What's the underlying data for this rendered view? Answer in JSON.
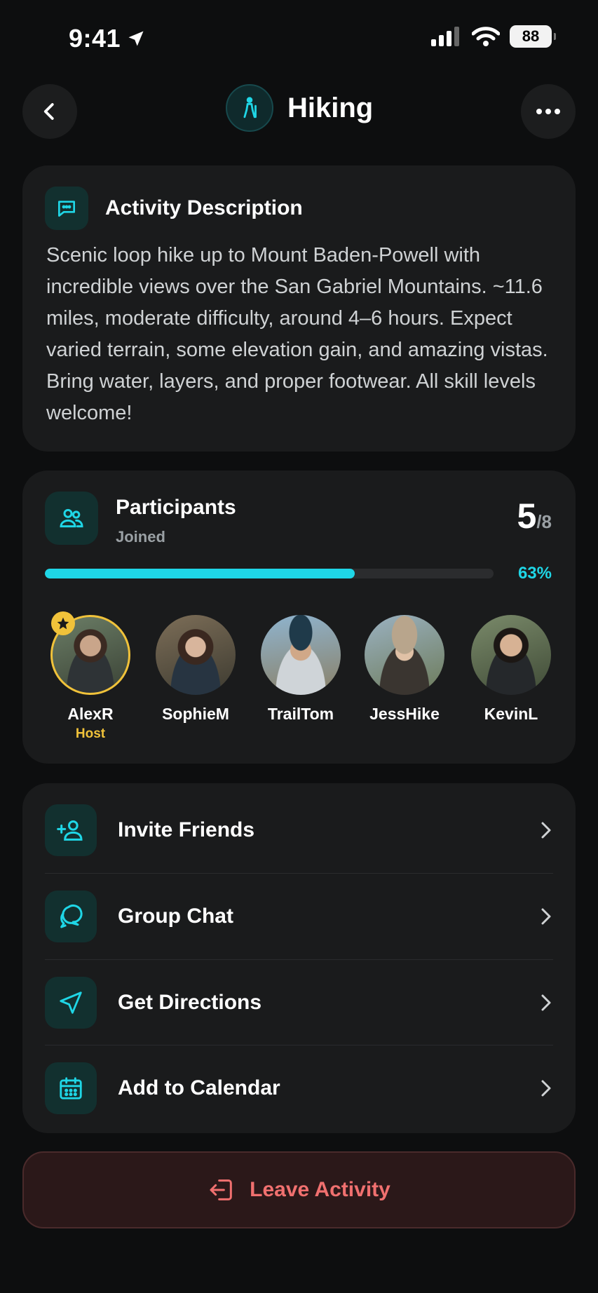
{
  "status_bar": {
    "time": "9:41",
    "battery": "88"
  },
  "header": {
    "title": "Hiking"
  },
  "description": {
    "title": "Activity Description",
    "text": "Scenic loop hike up to Mount Baden-Powell with incredible views over the San Gabriel Mountains. ~11.6 miles, moderate difficulty, around 4–6 hours. Expect varied terrain, some elevation gain, and amazing vistas. Bring water, layers, and proper footwear. All skill levels welcome!"
  },
  "participants": {
    "title": "Participants",
    "subtitle": "Joined",
    "count": "5",
    "max": "/8",
    "percent_label": "63%",
    "progress_fraction": 0.69,
    "people": [
      {
        "name": "AlexR",
        "role": "Host"
      },
      {
        "name": "SophieM"
      },
      {
        "name": "TrailTom"
      },
      {
        "name": "JessHike"
      },
      {
        "name": "KevinL"
      }
    ]
  },
  "actions": [
    {
      "label": "Invite Friends",
      "icon": "add-user-icon"
    },
    {
      "label": "Group Chat",
      "icon": "chat-icon"
    },
    {
      "label": "Get Directions",
      "icon": "navigation-icon"
    },
    {
      "label": "Add to Calendar",
      "icon": "calendar-icon"
    }
  ],
  "leave_button": {
    "label": "Leave Activity"
  },
  "colors": {
    "accent": "#1fd6e6",
    "host": "#f0c23a",
    "danger": "#f0706f",
    "background": "#0d0e0f",
    "card": "#1a1b1c"
  }
}
